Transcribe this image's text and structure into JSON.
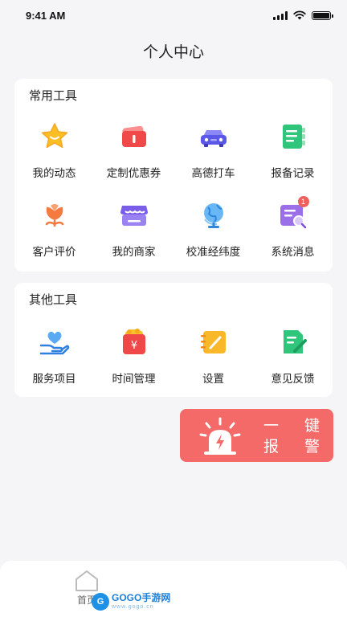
{
  "status_bar": {
    "time": "9:41 AM"
  },
  "header": {
    "title": "个人中心"
  },
  "common_tools": {
    "title": "常用工具",
    "items": [
      {
        "label": "我的动态",
        "icon": "star-icon"
      },
      {
        "label": "定制优惠券",
        "icon": "coupon-icon"
      },
      {
        "label": "高德打车",
        "icon": "car-icon"
      },
      {
        "label": "报备记录",
        "icon": "record-list-icon"
      },
      {
        "label": "客户评价",
        "icon": "flower-icon"
      },
      {
        "label": "我的商家",
        "icon": "store-icon"
      },
      {
        "label": "校准经纬度",
        "icon": "globe-icon"
      },
      {
        "label": "系统消息",
        "icon": "message-search-icon",
        "badge": "1"
      }
    ]
  },
  "other_tools": {
    "title": "其他工具",
    "items": [
      {
        "label": "服务项目",
        "icon": "heart-hand-icon"
      },
      {
        "label": "时间管理",
        "icon": "red-envelope-icon"
      },
      {
        "label": "设置",
        "icon": "notepad-icon"
      },
      {
        "label": "意见反馈",
        "icon": "feedback-edit-icon"
      }
    ]
  },
  "sos": {
    "line1_a": "一",
    "line1_b": "键",
    "line2_a": "报",
    "line2_b": "警"
  },
  "tabbar": {
    "home_label": "首页"
  },
  "watermark": {
    "main": "GOGO手游网",
    "sub": "www.gogo.cn"
  },
  "colors": {
    "accent_red": "#f46a68",
    "background": "#f5f5f7"
  }
}
